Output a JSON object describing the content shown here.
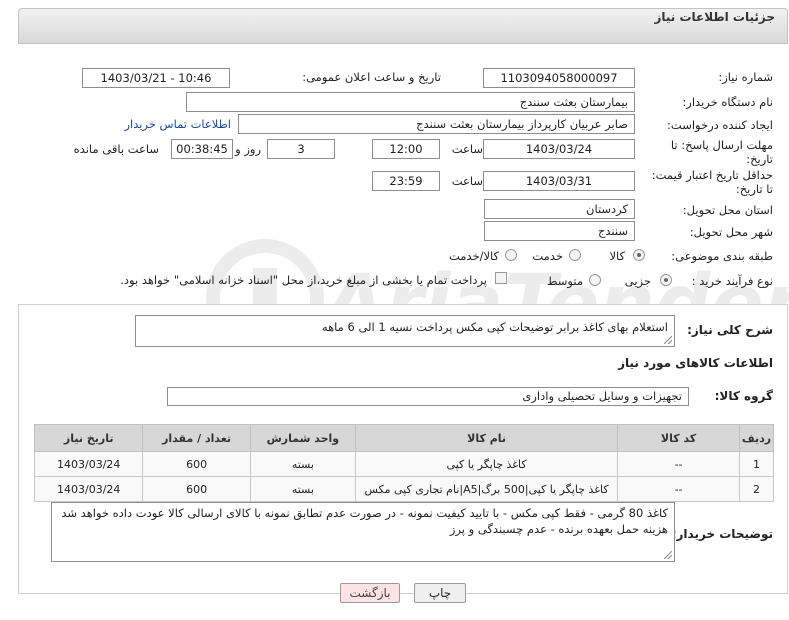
{
  "header": {
    "title": "جزئیات اطلاعات نیاز"
  },
  "fields": {
    "need_number_label": "شماره نیاز:",
    "need_number": "1103094058000097",
    "announce_label": "تاریخ و ساعت اعلان عمومی:",
    "announce_value": "1403/03/21 - 10:46",
    "buyer_org_label": "نام دستگاه خریدار:",
    "buyer_org": "بیمارستان بعثت سنندج",
    "requester_label": "ایجاد کننده درخواست:",
    "requester": "صابر عربیان کارپرداز بیمارستان بعثت سنندج",
    "buyer_contact_link": "اطلاعات تماس خریدار",
    "reply_deadline_label": "مهلت ارسال پاسخ: تا تاریخ:",
    "reply_date": "1403/03/24",
    "time_label": "ساعت",
    "reply_time": "12:00",
    "days_value": "3",
    "days_label": "روز و",
    "remaining_time": "00:38:45",
    "remaining_label": "ساعت باقی مانده",
    "validity_label": "حداقل تاریخ اعتبار قیمت: تا تاریخ:",
    "validity_date": "1403/03/31",
    "validity_time": "23:59",
    "province_label": "استان محل تحویل:",
    "province": "کردستان",
    "city_label": "شهر محل تحویل:",
    "city": "سنندج",
    "category_label": "طبقه بندی موضوعی:",
    "category_goods": "کالا",
    "category_service": "خدمت",
    "category_both": "کالا/خدمت",
    "purchase_type_label": "نوع فرآیند خرید :",
    "purchase_partial": "جزیی",
    "purchase_medium": "متوسط",
    "payment_note": "پرداخت تمام یا بخشی از مبلغ خرید،از محل \"اسناد خزانه اسلامی\" خواهد بود."
  },
  "details": {
    "summary_label": "شرح کلی نیاز:",
    "summary": "استعلام بهای کاغذ برابر توضیحات کپی مکس پرداخت نسیه 1 الی 6 ماهه",
    "goods_info_title": "اطلاعات کالاهای مورد نیاز",
    "group_label": "گروه کالا:",
    "group_value": "تجهیزات و وسایل تحصیلی واداری",
    "table": {
      "headers": [
        "ردیف",
        "کد کالا",
        "نام کالا",
        "واحد شمارش",
        "تعداد / مقدار",
        "تاریخ نیاز"
      ],
      "rows": [
        [
          "1",
          "--",
          "کاغذ چاپگر یا کپی",
          "بسته",
          "600",
          "1403/03/24"
        ],
        [
          "2",
          "--",
          "کاغذ چاپگر یا کپی|500 برگ|A5|نام تجاری کپی مکس",
          "بسته",
          "600",
          "1403/03/24"
        ]
      ]
    },
    "buyer_notes_label": "توضیحات خریدار:",
    "buyer_notes": "کاغذ 80 گرمی - فقط کپی مکس - با تایید کیفیت نمونه - در صورت عدم تطابق نمونه با کالای ارسالی کالا عودت داده خواهد شد هزینه حمل بعهده برنده - عدم چسبندگی و پرز"
  },
  "buttons": {
    "print": "چاپ",
    "back": "بازگشت"
  },
  "colors": {
    "link": "#1a49a8",
    "back_button": "#fde3e3",
    "print_button": "#efefef"
  }
}
